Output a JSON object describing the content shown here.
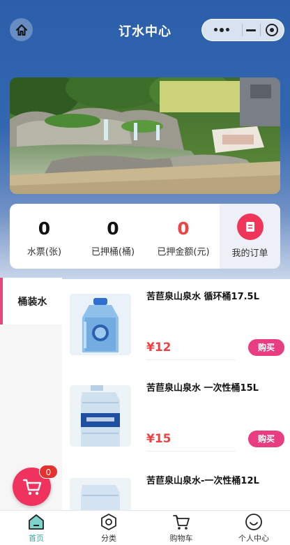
{
  "header": {
    "title": "订水中心"
  },
  "stats": [
    {
      "value": "0",
      "label": "水票(张)"
    },
    {
      "value": "0",
      "label": "已押桶(桶)"
    },
    {
      "value": "0",
      "label": "已押金额(元)"
    }
  ],
  "orders": {
    "label": "我的订单"
  },
  "categories": [
    {
      "label": "桶装水"
    }
  ],
  "products": [
    {
      "name": "苦苣泉山泉水 循环桶17.5L",
      "price": "¥12",
      "buy_label": "购买"
    },
    {
      "name": "苦苣泉山泉水 一次性桶15L",
      "price": "¥15",
      "buy_label": "购买"
    },
    {
      "name": "苦苣泉山泉水-一次性桶12L"
    }
  ],
  "cart_fab": {
    "count": "0"
  },
  "tabbar": [
    {
      "label": "首页",
      "icon": "home-icon",
      "active": true
    },
    {
      "label": "分类",
      "icon": "category-icon",
      "active": false
    },
    {
      "label": "购物车",
      "icon": "cart-icon",
      "active": false
    },
    {
      "label": "个人中心",
      "icon": "profile-icon",
      "active": false
    }
  ],
  "colors": {
    "accent_pink": "#e93d82",
    "price_red": "#ec4444",
    "tab_active": "#3aa9a3",
    "header_blue": "#2b5fa9"
  }
}
